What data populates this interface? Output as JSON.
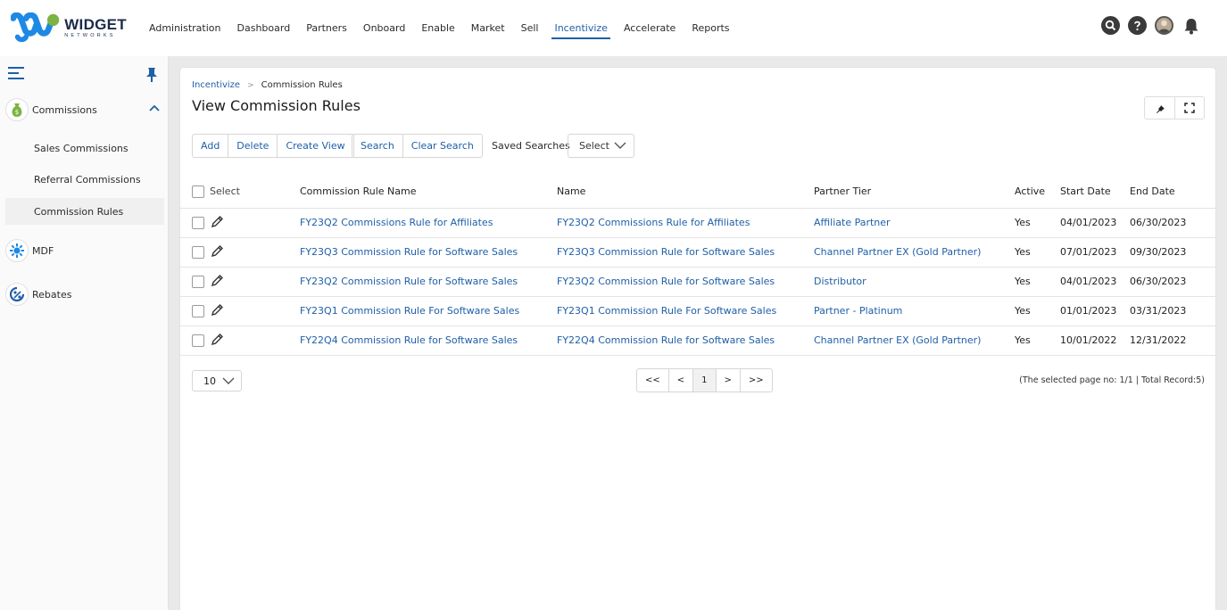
{
  "brand": {
    "name": "WIDGET",
    "tagline": "NETWORKS"
  },
  "nav": {
    "items": [
      "Administration",
      "Dashboard",
      "Partners",
      "Onboard",
      "Enable",
      "Market",
      "Sell",
      "Incentivize",
      "Accelerate",
      "Reports"
    ],
    "active": "Incentivize"
  },
  "sidebar": {
    "sections": [
      {
        "label": "Commissions",
        "icon": "money-bag-icon",
        "expanded": true,
        "items": [
          "Sales Commissions",
          "Referral Commissions",
          "Commission Rules"
        ],
        "selected": "Commission Rules"
      },
      {
        "label": "MDF",
        "icon": "gear-network-icon"
      },
      {
        "label": "Rebates",
        "icon": "percent-rebate-icon"
      }
    ]
  },
  "breadcrumb": {
    "parent": "Incentivize",
    "current": "Commission Rules"
  },
  "page": {
    "title": "View Commission Rules"
  },
  "toolbar": {
    "group1": [
      "Add",
      "Delete",
      "Create View"
    ],
    "group2": [
      "Search",
      "Clear Search"
    ],
    "saved_searches_label": "Saved Searches",
    "saved_searches_value": "Select"
  },
  "table": {
    "columns": [
      "Select",
      "Commission Rule Name",
      "Name",
      "Partner Tier",
      "Active",
      "Start Date",
      "End Date"
    ],
    "rows": [
      {
        "rule": "FY23Q2 Commissions Rule for Affiliates",
        "name": "FY23Q2 Commissions Rule for Affiliates",
        "tier": "Affiliate Partner",
        "active": "Yes",
        "start": "04/01/2023",
        "end": "06/30/2023"
      },
      {
        "rule": "FY23Q3 Commission Rule for Software Sales",
        "name": "FY23Q3 Commission Rule for Software Sales",
        "tier": "Channel Partner EX (Gold Partner)",
        "active": "Yes",
        "start": "07/01/2023",
        "end": "09/30/2023"
      },
      {
        "rule": "FY23Q2 Commission Rule for Software Sales",
        "name": "FY23Q2 Commission Rule for Software Sales",
        "tier": "Distributor",
        "active": "Yes",
        "start": "04/01/2023",
        "end": "06/30/2023"
      },
      {
        "rule": "FY23Q1 Commission Rule For Software Sales",
        "name": "FY23Q1 Commission Rule For Software Sales",
        "tier": "Partner - Platinum",
        "active": "Yes",
        "start": "01/01/2023",
        "end": "03/31/2023"
      },
      {
        "rule": "FY22Q4 Commission Rule for Software Sales",
        "name": "FY22Q4 Commission Rule for Software Sales",
        "tier": "Channel Partner EX (Gold Partner)",
        "active": "Yes",
        "start": "10/01/2022",
        "end": "12/31/2022"
      }
    ]
  },
  "pagination": {
    "page_size": "10",
    "buttons": [
      "<<",
      "<",
      "1",
      ">",
      ">>"
    ],
    "current": "1",
    "info": "(The selected page no: 1/1 | Total Record:5)"
  },
  "colors": {
    "accent": "#1f5fa8",
    "logo_blue": "#1e88e5",
    "logo_green": "#7cb342",
    "panel_bg": "#e9e9e9"
  }
}
